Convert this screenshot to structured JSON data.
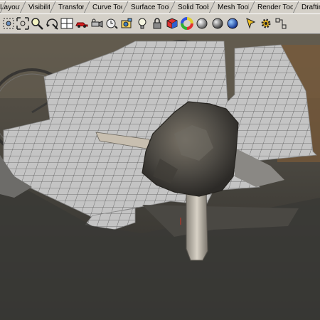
{
  "tabs": [
    {
      "label": "Layout"
    },
    {
      "label": "Visibility"
    },
    {
      "label": "Transform"
    },
    {
      "label": "Curve Tools"
    },
    {
      "label": "Surface Tools"
    },
    {
      "label": "Solid Tools"
    },
    {
      "label": "Mesh Tools"
    },
    {
      "label": "Render Tools"
    },
    {
      "label": "Drafting"
    }
  ],
  "toolbar": {
    "icons": [
      "zoom-extents-icon",
      "zoom-window-icon",
      "zoom-selected-icon",
      "rotate-view-icon",
      "four-viewports-icon",
      "car-icon",
      "camera-icon",
      "named-view-icon",
      "snapshot-icon",
      "light-bulb-icon",
      "lock-icon",
      "render-material-icon",
      "color-wheel-icon",
      "shaded-sphere-icon",
      "render-sphere-icon",
      "blue-sphere-icon",
      "pointer-icon",
      "settings-gear-icon",
      "point-select-icon"
    ]
  },
  "viewport": {
    "name": "perspective-viewport",
    "colors": {
      "grid_plane": "#c4c4c4",
      "grid_lines": "#555555",
      "rock": "#5a5650",
      "handle": "#b9b2a6"
    }
  }
}
